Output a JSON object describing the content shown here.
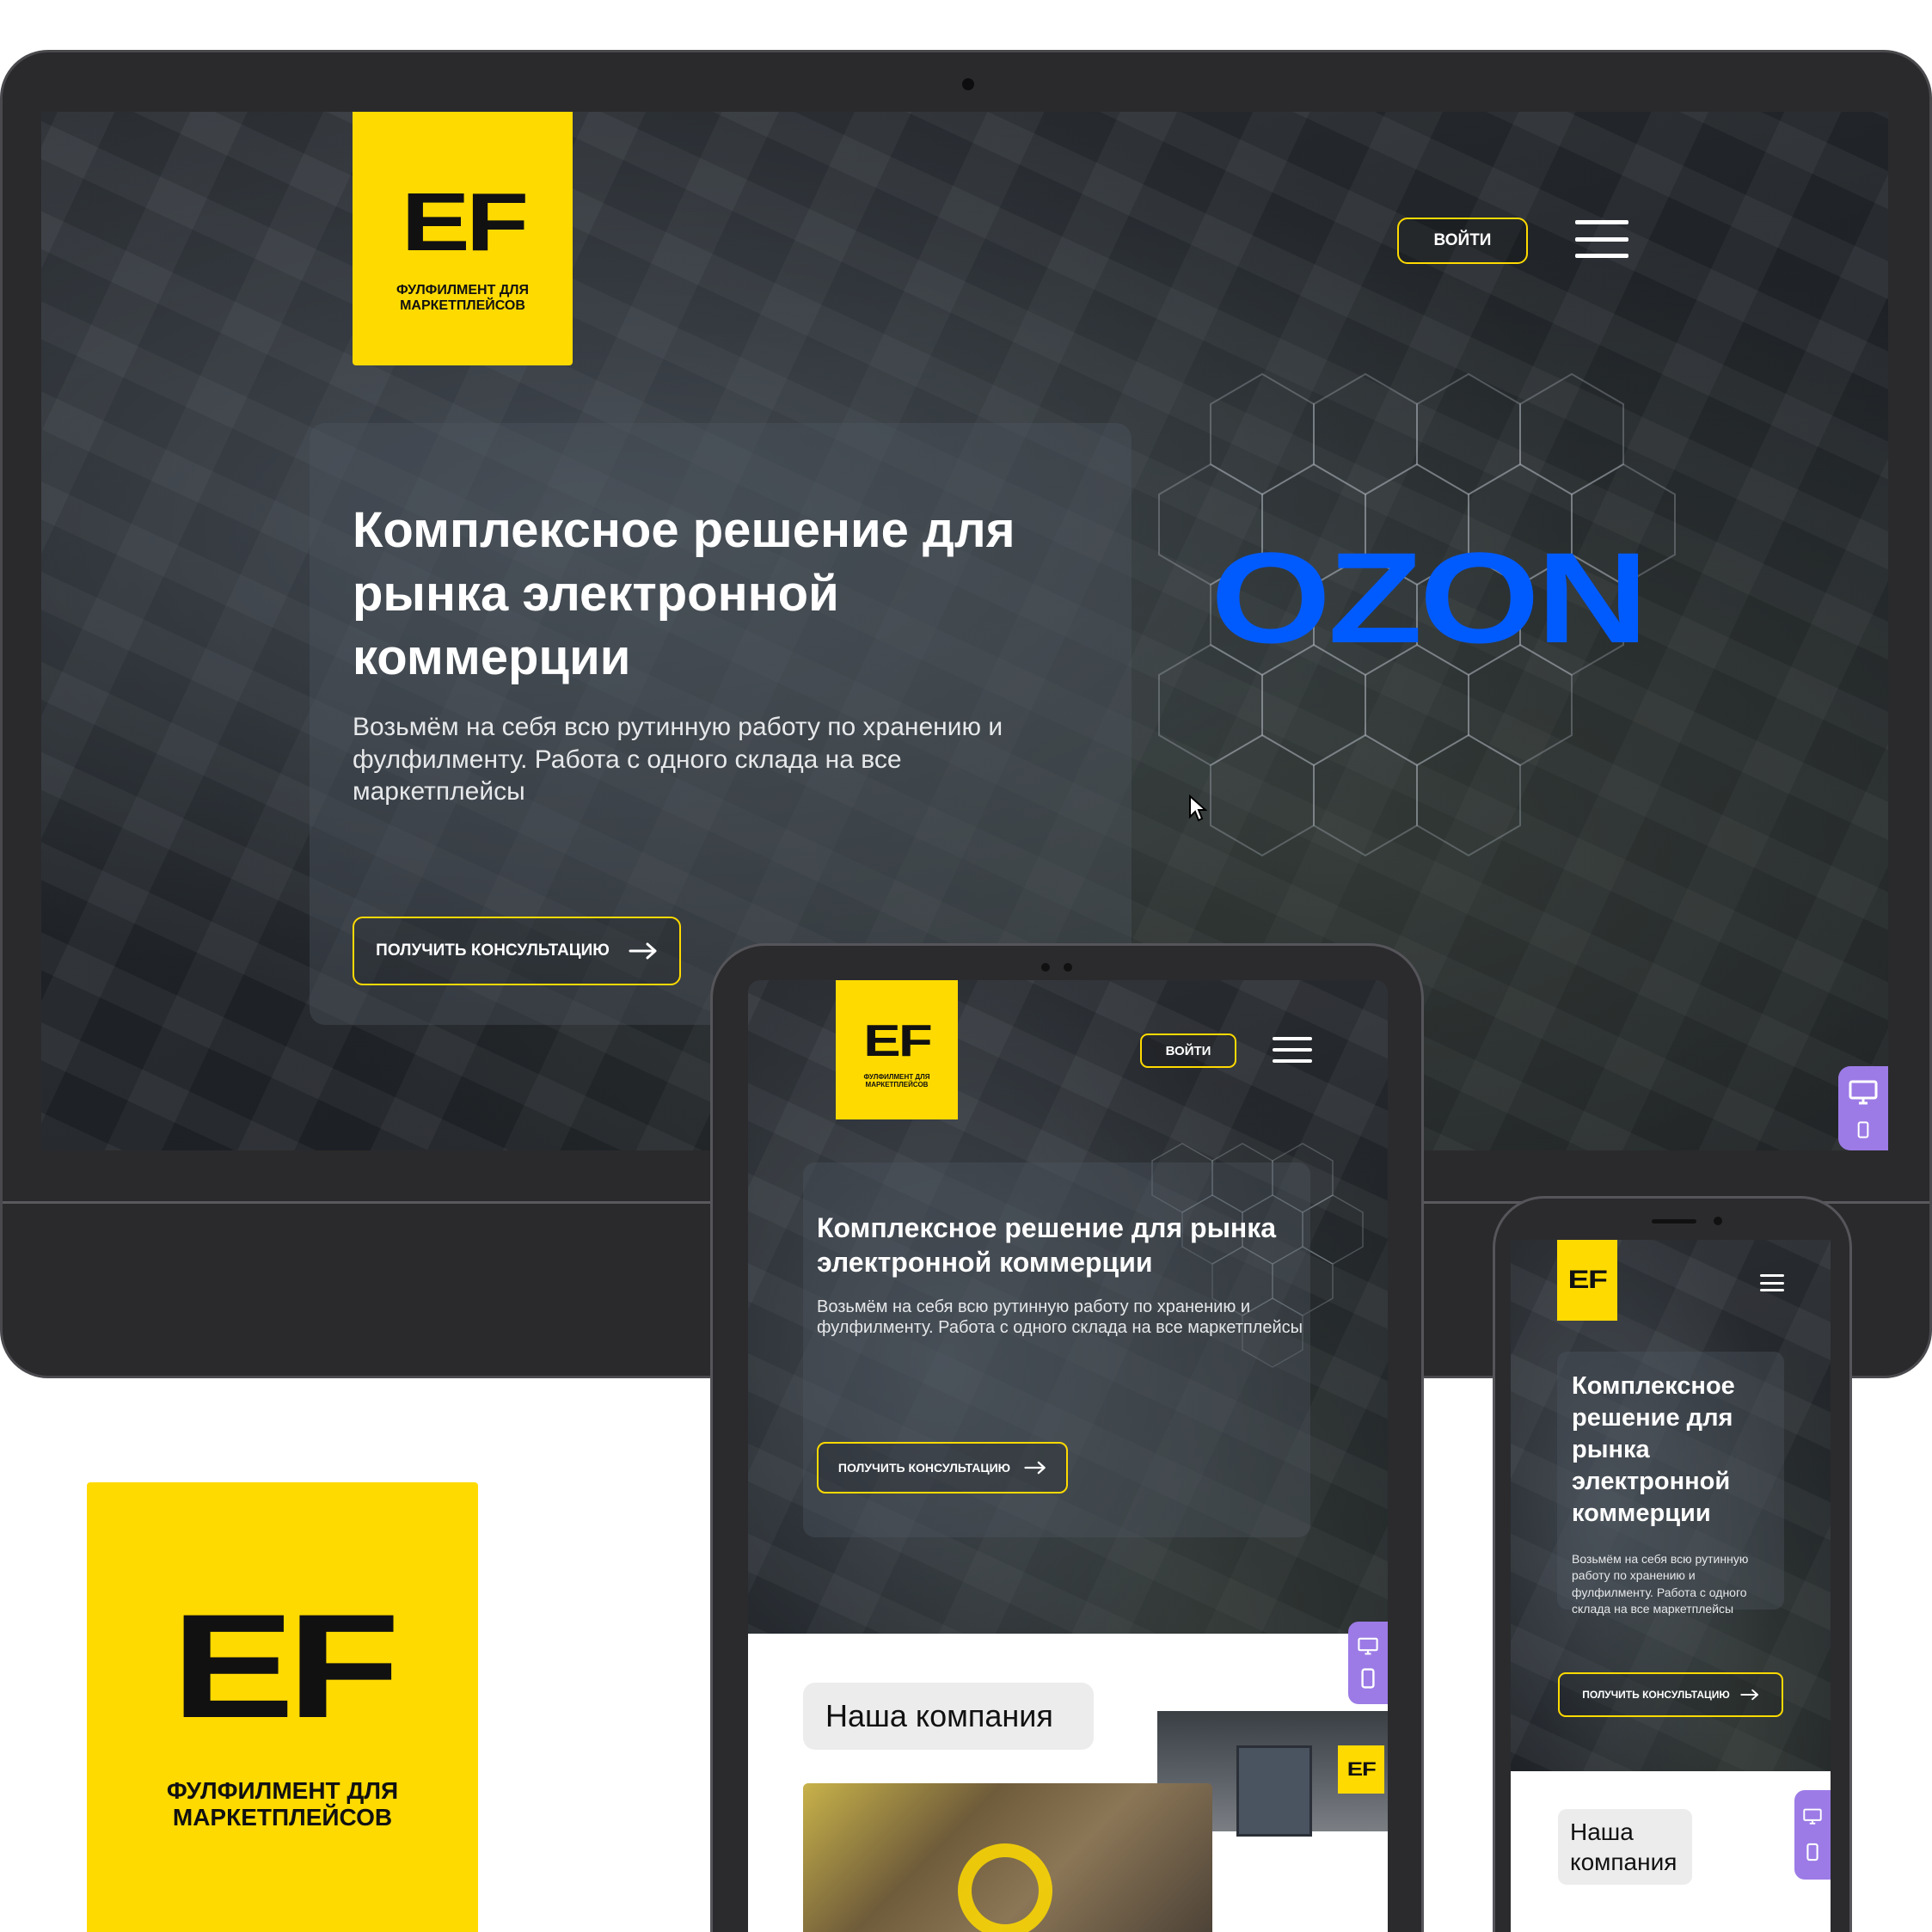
{
  "brand": {
    "mark": "EF",
    "tagline_line1": "ФУЛФИЛМЕНТ ДЛЯ",
    "tagline_line2": "МАРКЕТПЛЕЙСОВ",
    "accent_color": "#FFDA00"
  },
  "nav": {
    "login_label": "ВОЙТИ",
    "menu_icon": "hamburger-icon"
  },
  "hero": {
    "title": "Комплексное решение для рынка электронной коммерции",
    "description": "Возьмём на себя всю рутинную работу по хранению и фулфилменту. Работа с одного склада на все маркетплейсы",
    "cta_label": "ПОЛУЧИТЬ КОНСУЛЬТАЦИЮ",
    "cta_icon": "arrow-right-icon",
    "partner_logo": "OZON",
    "partner_color": "#005BFF"
  },
  "about": {
    "heading": "Наша компания"
  },
  "device_switcher": {
    "desktop_icon": "desktop-icon",
    "mobile_icon": "mobile-icon",
    "accent_color": "#9C7BE6"
  }
}
